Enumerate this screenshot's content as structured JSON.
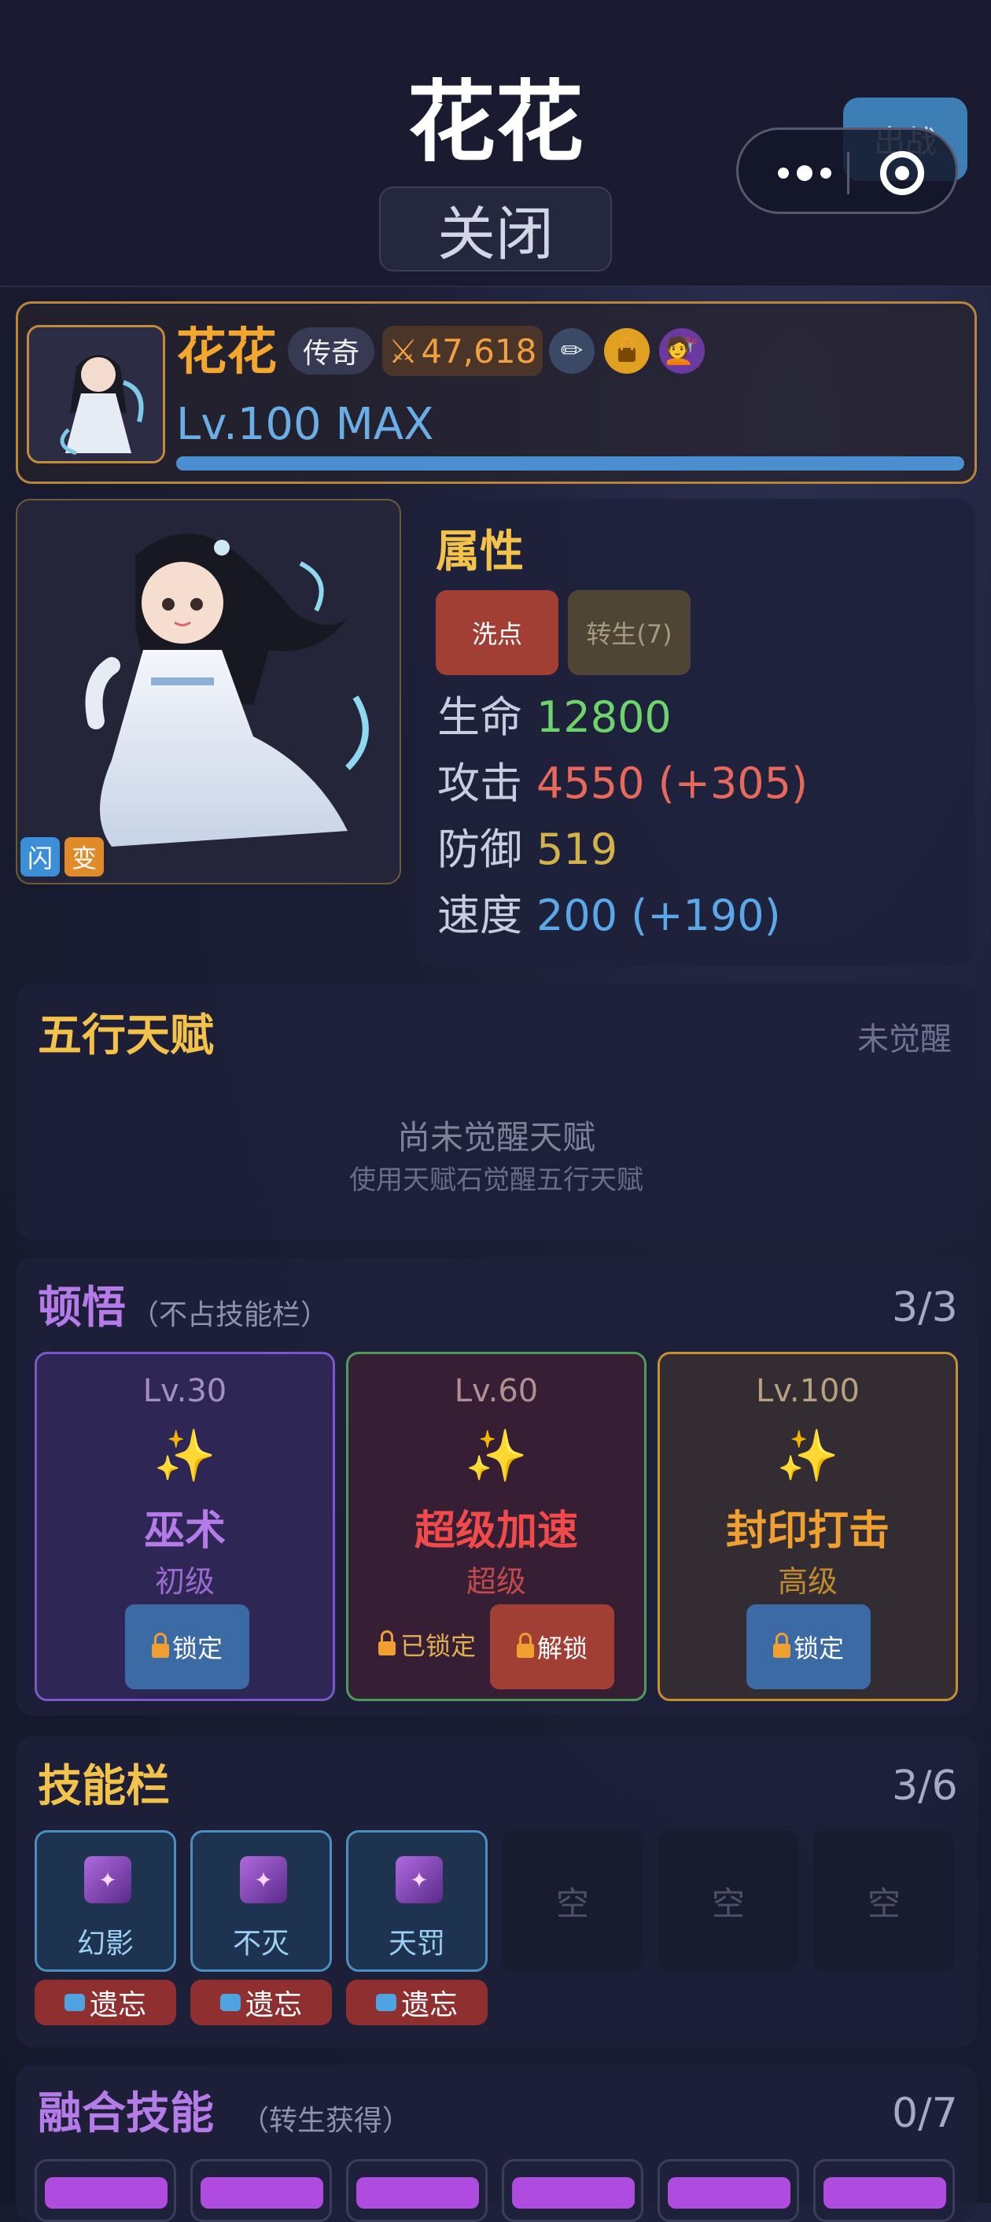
{
  "header": {
    "title": "花花",
    "close_label": "关闭",
    "deploy_label": "出战"
  },
  "hero": {
    "name": "花花",
    "rarity": "传奇",
    "power": "47,618",
    "level_text": "Lv.100 MAX",
    "xp_progress": 1.0,
    "icons": [
      "sword-icon",
      "pencil-icon",
      "lock-icon",
      "stylist-icon"
    ]
  },
  "portrait": {
    "tags": [
      {
        "label": "闪",
        "color": "#3c8fd6"
      },
      {
        "label": "变",
        "color": "#e08a2a"
      }
    ]
  },
  "attributes": {
    "title": "属性",
    "reset_label": "洗点",
    "rebirth_label": "转生(7)",
    "stats": [
      {
        "label": "生命",
        "value": "12800",
        "color": "#6cd46a"
      },
      {
        "label": "攻击",
        "value": "4550 (+305)",
        "color": "#e8685a"
      },
      {
        "label": "防御",
        "value": "519",
        "color": "#d4b24a"
      },
      {
        "label": "速度",
        "value": "200 (+190)",
        "color": "#5aa8e8"
      }
    ]
  },
  "talent": {
    "title": "五行天赋",
    "status": "未觉醒",
    "empty_title": "尚未觉醒天赋",
    "empty_hint": "使用天赋石觉醒五行天赋"
  },
  "insight": {
    "title": "顿悟",
    "subtitle": "（不占技能栏）",
    "count": "3/3",
    "items": [
      {
        "level": "Lv.30",
        "sparkle": "✨",
        "name": "巫术",
        "grade": "初级",
        "button": "锁定"
      },
      {
        "level": "Lv.60",
        "sparkle": "✨",
        "name": "超级加速",
        "grade": "超级",
        "locked_text": "已锁定",
        "button": "解锁"
      },
      {
        "level": "Lv.100",
        "sparkle": "✨",
        "name": "封印打击",
        "grade": "高级",
        "button": "锁定"
      }
    ]
  },
  "skills": {
    "title": "技能栏",
    "count": "3/6",
    "slots": [
      {
        "name": "幻影"
      },
      {
        "name": "不灭"
      },
      {
        "name": "天罚"
      }
    ],
    "empty_label": "空",
    "forget_label": "遗忘"
  },
  "fusion": {
    "title": "融合技能",
    "subtitle": "（转生获得）",
    "count": "0/7"
  }
}
